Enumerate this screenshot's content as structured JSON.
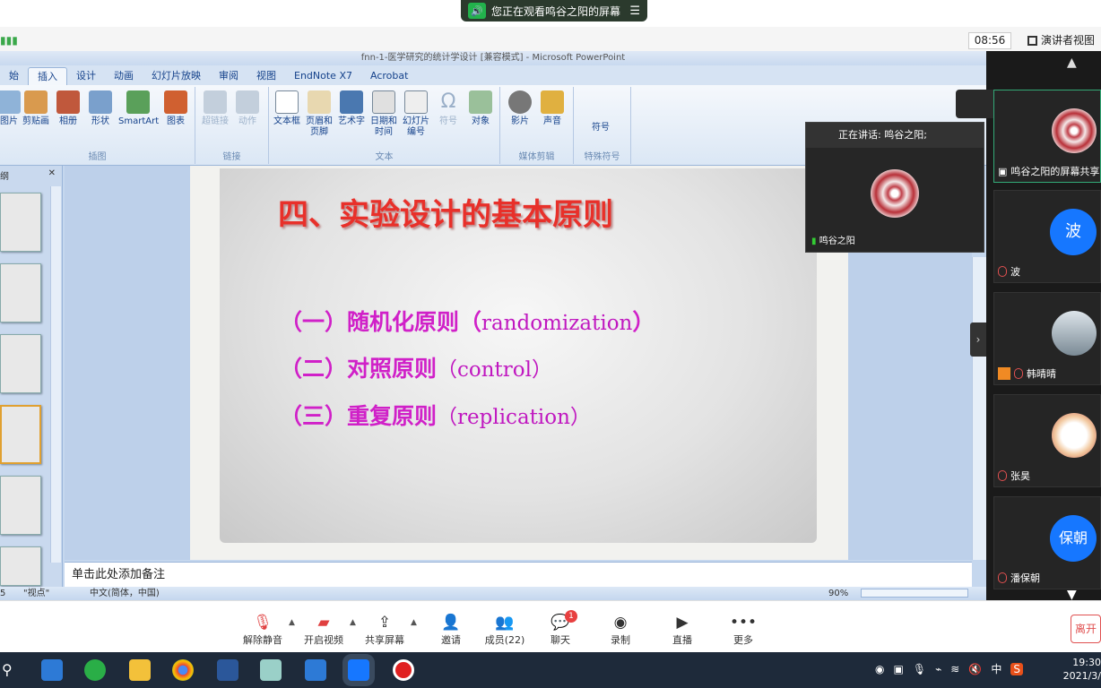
{
  "banner": {
    "text": "您正在观看鸣谷之阳的屏幕",
    "menu": "☰"
  },
  "meeting": {
    "clock": "08:56",
    "view_mode": "演讲者视图",
    "speaking_label": "正在讲话: 鸣谷之阳;"
  },
  "ppt": {
    "title": "fnn-1-医学研究的统计学设计 [兼容模式] - Microsoft PowerPoint",
    "tabs": [
      "始",
      "插入",
      "设计",
      "动画",
      "幻灯片放映",
      "审阅",
      "视图",
      "EndNote X7",
      "Acrobat"
    ],
    "active_tab": "插入",
    "groups": [
      {
        "label": "插图",
        "buttons": [
          "图片",
          "剪贴画",
          "相册",
          "形状",
          "SmartArt",
          "图表"
        ]
      },
      {
        "label": "链接",
        "buttons": [
          "超链接",
          "动作"
        ]
      },
      {
        "label": "文本",
        "buttons": [
          "文本框",
          "页眉和页脚",
          "艺术字",
          "日期和时间",
          "幻灯片编号",
          "符号",
          "对象"
        ]
      },
      {
        "label": "媒体剪辑",
        "buttons": [
          "影片",
          "声音"
        ]
      },
      {
        "label": "特殊符号",
        "buttons": [
          "符号"
        ]
      }
    ],
    "thumbs_header": "纲",
    "slide": {
      "title": "四、实验设计的基本原则",
      "lines": [
        {
          "cn": "（一）随机化原则（",
          "en": "randomization",
          "end": "）"
        },
        {
          "cn": "（二）对照原则",
          "en": "（control）",
          "end": ""
        },
        {
          "cn": "（三）重复原则",
          "en": "（replication）",
          "end": ""
        }
      ]
    },
    "notes_placeholder": "单击此处添加备注",
    "status": {
      "view": "\"视点\"",
      "language": "中文(简体，中国)",
      "zoom": "90%",
      "slide_no": "5"
    }
  },
  "speaker_video": {
    "header": "正在讲话: 鸣谷之阳;",
    "name": "鸣谷之阳"
  },
  "participants": [
    {
      "name": "鸣谷之阳的屏幕共享",
      "avatar": "rose"
    },
    {
      "name": "波",
      "avatar_text": "波",
      "color": "#1677ff"
    },
    {
      "name": "韩晴晴",
      "avatar": "photo"
    },
    {
      "name": "张昊",
      "avatar": "cartoon"
    },
    {
      "name": "潘保朝",
      "avatar_text": "保朝",
      "color": "#1677ff"
    }
  ],
  "toolbar": {
    "buttons": [
      {
        "label": "解除静音",
        "icon": "mic-muted-icon"
      },
      {
        "label": "开启视频",
        "icon": "video-off-icon"
      },
      {
        "label": "共享屏幕",
        "icon": "share-screen-icon"
      },
      {
        "label": "邀请",
        "icon": "invite-icon"
      },
      {
        "label": "成员(22)",
        "icon": "members-icon"
      },
      {
        "label": "聊天",
        "icon": "chat-icon"
      },
      {
        "label": "录制",
        "icon": "record-icon"
      },
      {
        "label": "直播",
        "icon": "live-icon"
      },
      {
        "label": "更多",
        "icon": "more-icon"
      }
    ],
    "chat_badge": "1",
    "leave": "离开"
  },
  "taskbar": {
    "time": "19:30",
    "date": "2021/3/",
    "ime": "中"
  }
}
